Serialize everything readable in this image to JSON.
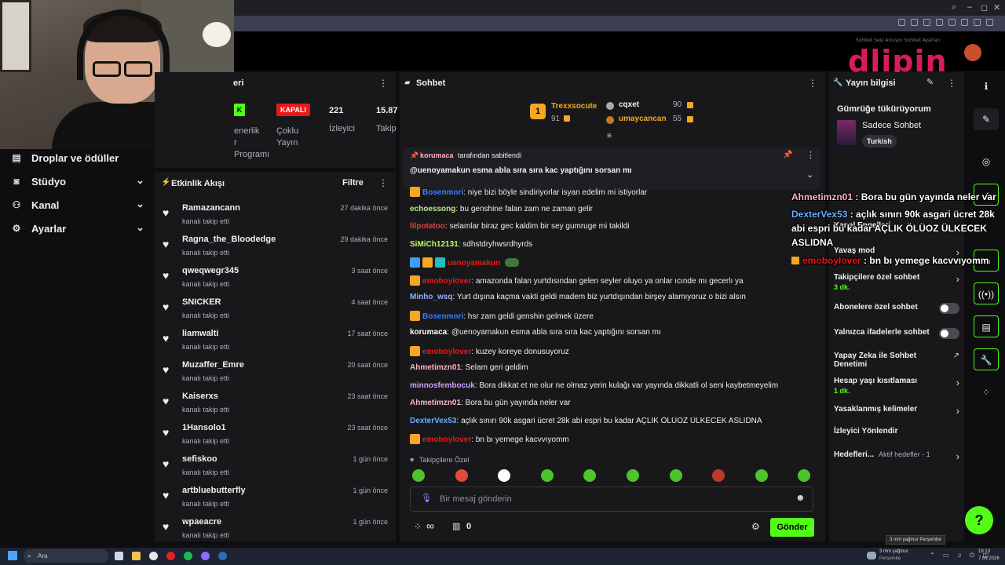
{
  "browser": {
    "win_min": "–",
    "win_max": "◻",
    "win_close": "✕"
  },
  "logo": {
    "text": "dlipin",
    "small_text": "Sohbet Sesi Alınıyor Sohbet Ayarları"
  },
  "sidenav": {
    "items": [
      {
        "label": "Droplar ve ödüller",
        "icon": "gift-icon"
      },
      {
        "label": "Stüdyo",
        "icon": "video-icon"
      },
      {
        "label": "Kanal",
        "icon": "users-icon"
      },
      {
        "label": "Ayarlar",
        "icon": "gear-icon"
      }
    ]
  },
  "mod_panel": {
    "title_partial": "eri",
    "stats": [
      {
        "num": "",
        "label": "enerlik\nr\nProgramı"
      },
      {
        "num": "KAPALI",
        "label": "Çoklu\nYayın"
      },
      {
        "num": "221",
        "label": "İzleyici"
      },
      {
        "num": "15.87",
        "label": "Takip"
      }
    ],
    "green_badge": "K"
  },
  "activity": {
    "title": "Etkinlik Akışı",
    "filter": "Filtre",
    "rows": [
      {
        "name": "Ramazancann",
        "sub": "kanalı takip etti",
        "time": "27 dakika önce"
      },
      {
        "name": "Ragna_the_Bloodedge",
        "sub": "kanalı takip etti",
        "time": "29 dakika önce"
      },
      {
        "name": "qweqwegr345",
        "sub": "kanalı takip etti",
        "time": "3 saat önce"
      },
      {
        "name": "SNICKER",
        "sub": "kanalı takip etti",
        "time": "4 saat önce"
      },
      {
        "name": "liamwalti",
        "sub": "kanalı takip etti",
        "time": "17 saat önce"
      },
      {
        "name": "Muzaffer_Emre",
        "sub": "kanalı takip etti",
        "time": "20 saat önce"
      },
      {
        "name": "Kaiserxs",
        "sub": "kanalı takip etti",
        "time": "23 saat önce"
      },
      {
        "name": "1Hansolo1",
        "sub": "kanalı takip etti",
        "time": "23 saat önce"
      },
      {
        "name": "sefiskoo",
        "sub": "kanalı takip etti",
        "time": "1 gün önce"
      },
      {
        "name": "artbluebutterfly",
        "sub": "kanalı takip etti",
        "time": "1 gün önce"
      },
      {
        "name": "wpaeacre",
        "sub": "kanalı takip etti",
        "time": "1 gün önce"
      }
    ]
  },
  "chat": {
    "title": "Sohbet",
    "leaderboard": {
      "first": {
        "name": "Trexxsocute",
        "points": "91"
      },
      "second": {
        "name": "cqxet",
        "points": "90"
      },
      "third": {
        "name": "umaycancan",
        "points": "55"
      }
    },
    "pinned": {
      "by": "korumaca",
      "by_suffix": "tarafından sabitlendi",
      "text": "@uenoyamakun esma abla sıra sıra kac yaptığını sorsan mı"
    },
    "messages": [
      {
        "user": "Bosenmori",
        "color": "#3a7cff",
        "text": "niye bizi böyle sindiriyorlar isyan edelim mi istiyorlar",
        "badges": [
          "#f5a623"
        ]
      },
      {
        "user": "echoessong",
        "color": "#c0e68a",
        "text": "bu genshine falan zam ne zaman gelir",
        "badges": []
      },
      {
        "user": "lilpotatoo",
        "color": "#e04040",
        "text": "selamlar biraz gec kaldim bir sey gumruge mi takildi",
        "badges": []
      },
      {
        "user": "SiMiCh12131",
        "color": "#b6ff6a",
        "text": "sdhstdryhwsrdhyrds",
        "badges": []
      },
      {
        "user": "uenoyamakun",
        "color": "#e91916",
        "text": "",
        "badges": [
          "#3aa0ff",
          "#f5a623",
          "#1fbfbf"
        ]
      },
      {
        "user": "emoboylover",
        "color": "#e91916",
        "text": "amazonda falan yurtdısından gelen seyler oluyo ya onlar ıcınde mı gecerlı ya",
        "badges": [
          "#f5a623"
        ]
      },
      {
        "user": "Minho_wsq",
        "color": "#8fb3ff",
        "text": "Yurt dışına kaçma vakti geldi madem biz yurtdışından birşey alamıyoruz o bizi alsın",
        "badges": []
      },
      {
        "user": "Bosenmori",
        "color": "#3a7cff",
        "text": "hsr zam geldi genshin gelmek üzere",
        "badges": [
          "#f5a623"
        ]
      },
      {
        "user": "korumaca",
        "color": "#ffffff",
        "text": "@uenoyamakun esma abla sıra sıra kac yaptığını sorsan mı",
        "badges": []
      },
      {
        "user": "emoboylover",
        "color": "#e91916",
        "text": "kuzey koreye donusuyoruz",
        "badges": [
          "#f5a623"
        ]
      },
      {
        "user": "Ahmetimzn01",
        "color": "#ffb0c0",
        "text": "Selam geri geldim",
        "badges": []
      },
      {
        "user": "minnosfembocuk",
        "color": "#c9a0ff",
        "text": "Bora dikkat et ne olur ne olmaz yerin kulağı var yayında dikkatli ol seni kaybetmeyelim",
        "badges": []
      },
      {
        "user": "Ahmetimzn01",
        "color": "#ffb0c0",
        "text": "Bora bu gün yayında neler var",
        "badges": []
      },
      {
        "user": "DexterVex53",
        "color": "#6ab0ff",
        "text": "açlık sınırı 90k asgari ücret 28k abi espri bu kadar AÇLIK ÖLÜOZ ÜLKECEK ASLIDNA",
        "badges": []
      },
      {
        "user": "emoboylover",
        "color": "#e91916",
        "text": "bn bı yemege kacvvıyomm",
        "badges": [
          "#f5a623"
        ]
      }
    ],
    "followers_only": "Takipçilere Özel",
    "input_placeholder": "Bir mesaj gönderin",
    "points": "0",
    "infinity": "∞",
    "send": "Gönder",
    "emotes": [
      "#4ec42b",
      "#e04a3a",
      "#ffffff",
      "#4ec42b",
      "#4ec42b",
      "#4ec42b",
      "#4ec42b",
      "#c0392b",
      "#4ec42b",
      "#4ec42b"
    ]
  },
  "info": {
    "title": "Yayın bilgisi",
    "stream_title": "Gümrüğe tükürüyorum",
    "category": "Sadece Sohbet",
    "language": "Turkish",
    "settings": [
      {
        "label": "Kanal Engelleri",
        "sub": ""
      },
      {
        "label": "Yavaş mod",
        "sub": ""
      },
      {
        "label": "Takipçilere özel sohbet",
        "sub": "3 dk."
      },
      {
        "label": "Abonelere özel sohbet",
        "sub": ""
      },
      {
        "label": "Yalnızca ifadelerle sohbet",
        "sub": ""
      },
      {
        "label": "Yapay Zeka ile Sohbet Denetimi",
        "sub": ""
      },
      {
        "label": "Hesap yaşı kısıtlaması",
        "sub": "1 dk."
      },
      {
        "label": "Yasaklanmış kelimeler",
        "sub": ""
      },
      {
        "label": "İzleyici Yönlendir",
        "sub": ""
      },
      {
        "label": "Hedefleri...",
        "sub": "Aktif hedefler - 1"
      }
    ]
  },
  "overlay": {
    "lines": [
      {
        "user": "Ahmetimzn01",
        "color": "#ffb0c0",
        "text": " : Bora bu gün yayında neler var"
      },
      {
        "user": "DexterVex53",
        "color": "#6ab0ff",
        "text": " : açlık sınırı 90k asgari ücret 28k"
      },
      {
        "user": "",
        "color": "#ffffff",
        "text": "abi espri bu kadar AÇLIK ÖLÜOZ ÜLKECEK"
      },
      {
        "user": "",
        "color": "#ffffff",
        "text": "ASLIDNA"
      },
      {
        "user": "emoboylover",
        "color": "#e91916",
        "text": " : bn bı yemege kacvvıyomm"
      }
    ]
  },
  "taskbar": {
    "search": "Ara",
    "weather": "3 mm yağmur",
    "weather_sub": "Perşembe",
    "tooltip": "3 mm yağmur Perşembe",
    "time": "19:13",
    "date": "7.01.2026"
  }
}
